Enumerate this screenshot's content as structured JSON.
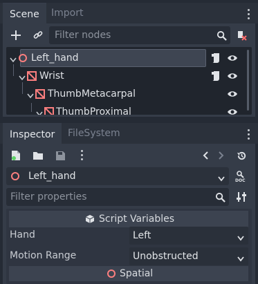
{
  "scene_dock": {
    "tabs": [
      {
        "label": "Scene",
        "active": true
      },
      {
        "label": "Import",
        "active": false
      }
    ],
    "filter_placeholder": "Filter nodes",
    "tree": [
      {
        "label": "Left_hand",
        "selected": true,
        "has_script": true,
        "visible": true
      },
      {
        "label": "Wrist",
        "selected": false,
        "has_script": true,
        "visible": true
      },
      {
        "label": "ThumbMetacarpal",
        "selected": false,
        "has_script": false,
        "visible": true
      },
      {
        "label": "ThumbProximal",
        "selected": false,
        "has_script": false,
        "visible": true
      }
    ]
  },
  "inspector_dock": {
    "tabs": [
      {
        "label": "Inspector",
        "active": true
      },
      {
        "label": "FileSystem",
        "active": false
      }
    ],
    "object_name": "Left_hand",
    "filter_placeholder": "Filter properties",
    "sections": {
      "script_variables": "Script Variables",
      "spatial": "Spatial"
    },
    "properties": [
      {
        "label": "Hand",
        "value": "Left"
      },
      {
        "label": "Motion Range",
        "value": "Unobstructed"
      }
    ]
  },
  "colors": {
    "node_icon": "#fc7f7f",
    "accent_text": "#e6e9ed"
  },
  "icons": [
    "add-node-icon",
    "link-icon",
    "search-icon",
    "filter-script-icon",
    "script-icon",
    "visibility-eye-icon",
    "new-resource-icon",
    "open-folder-icon",
    "save-icon",
    "history-back-icon",
    "history-forward-icon",
    "object-history-icon",
    "doc-icon",
    "property-settings-icon",
    "cube-icon"
  ]
}
